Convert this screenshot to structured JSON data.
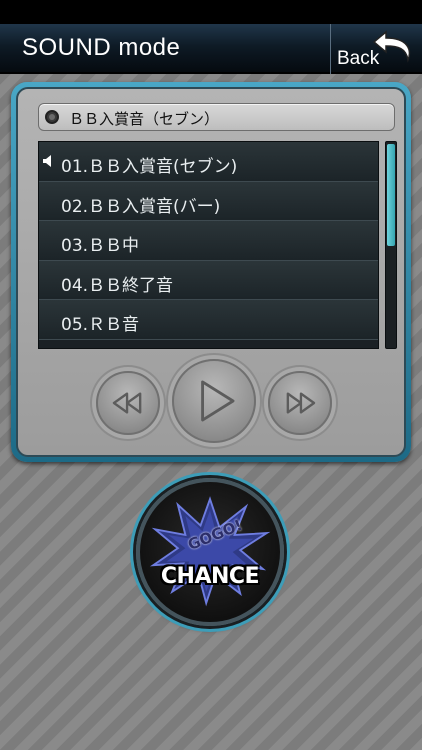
{
  "header": {
    "title": "SOUND mode",
    "back_label": "Back",
    "back_icon": "back-arrow-icon"
  },
  "player": {
    "now_playing": "ＢＢ入賞音（セブン）",
    "tracks": [
      {
        "label": "01.ＢＢ入賞音(セブン)",
        "playing": true
      },
      {
        "label": "02.ＢＢ入賞音(バー)",
        "playing": false
      },
      {
        "label": "03.ＢＢ中",
        "playing": false
      },
      {
        "label": "04.ＢＢ終了音",
        "playing": false
      },
      {
        "label": "05.ＲＢ音",
        "playing": false
      }
    ],
    "scroll_fraction": 0.5,
    "controls": {
      "rewind_icon": "rewind-icon",
      "play_icon": "play-icon",
      "forward_icon": "fast-forward-icon"
    }
  },
  "chance": {
    "top_text": "GOGO!",
    "label": "CHANCE"
  },
  "colors": {
    "accent": "#3d9db8",
    "panel_frame": "#49a7c6",
    "scroll_thumb": "#6ed3dc",
    "header_bg": "#0e1b26"
  }
}
